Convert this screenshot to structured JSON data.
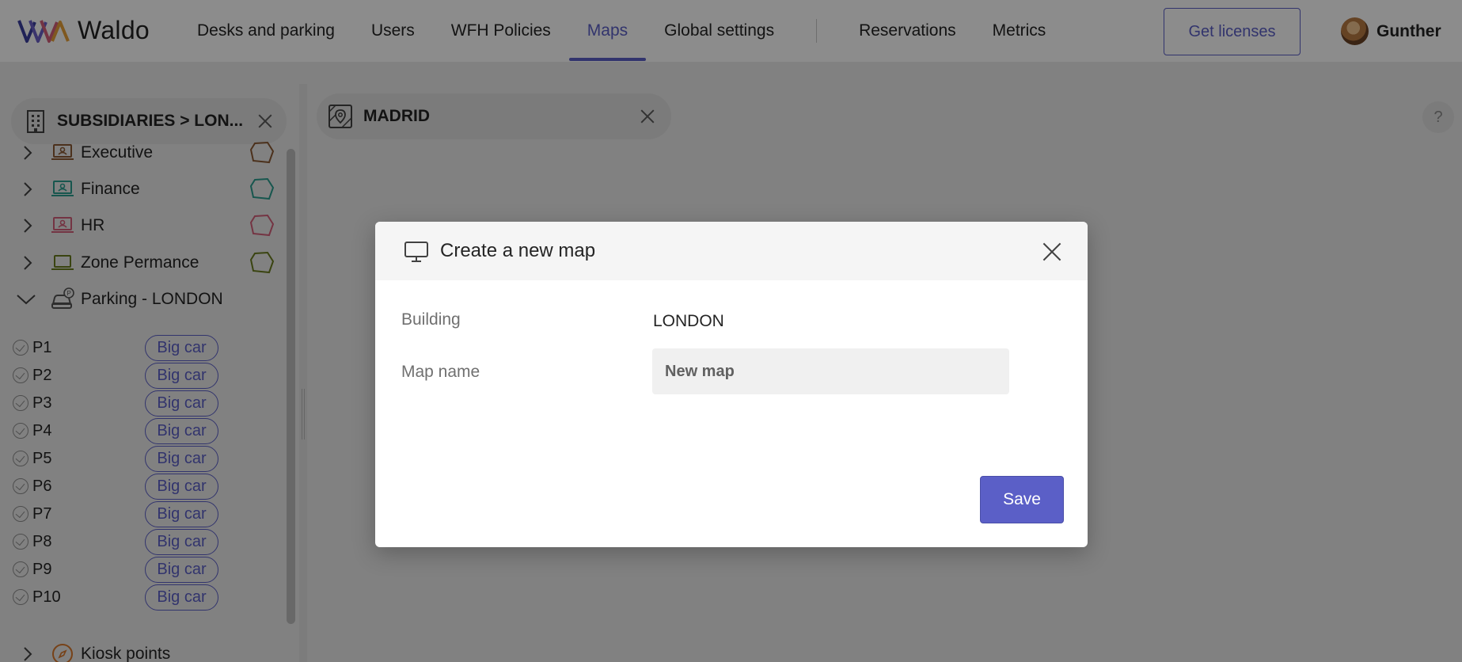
{
  "app": {
    "logo_text": "Waldo"
  },
  "nav": {
    "items": [
      "Desks and parking",
      "Users",
      "WFH Policies",
      "Maps",
      "Global settings"
    ],
    "items_right": [
      "Reservations",
      "Metrics"
    ],
    "active": "Maps",
    "get_licenses": "Get licenses",
    "user_name": "Gunther"
  },
  "sidebar": {
    "breadcrumb": "SUBSIDIARIES > LON...",
    "zones": [
      {
        "label": "Executive",
        "color": "#8a5a34"
      },
      {
        "label": "Finance",
        "color": "#2a9d8f"
      },
      {
        "label": "HR",
        "color": "#d4607a"
      },
      {
        "label": "Zone Permance",
        "color": "#6b7d1f"
      }
    ],
    "parking": {
      "label": "Parking - LONDON",
      "spots": [
        {
          "name": "P1",
          "tag": "Big car"
        },
        {
          "name": "P2",
          "tag": "Big car"
        },
        {
          "name": "P3",
          "tag": "Big car"
        },
        {
          "name": "P4",
          "tag": "Big car"
        },
        {
          "name": "P5",
          "tag": "Big car"
        },
        {
          "name": "P6",
          "tag": "Big car"
        },
        {
          "name": "P7",
          "tag": "Big car"
        },
        {
          "name": "P8",
          "tag": "Big car"
        },
        {
          "name": "P9",
          "tag": "Big car"
        },
        {
          "name": "P10",
          "tag": "Big car"
        }
      ]
    },
    "kiosk": {
      "label": "Kiosk points",
      "color": "#d9782d"
    }
  },
  "main": {
    "map_tab": "MADRID",
    "help": "?"
  },
  "modal": {
    "title": "Create a new map",
    "building_label": "Building",
    "building_value": "LONDON",
    "map_name_label": "Map name",
    "map_name_placeholder": "New map",
    "save": "Save"
  },
  "colors": {
    "accent": "#5b5fc7"
  }
}
